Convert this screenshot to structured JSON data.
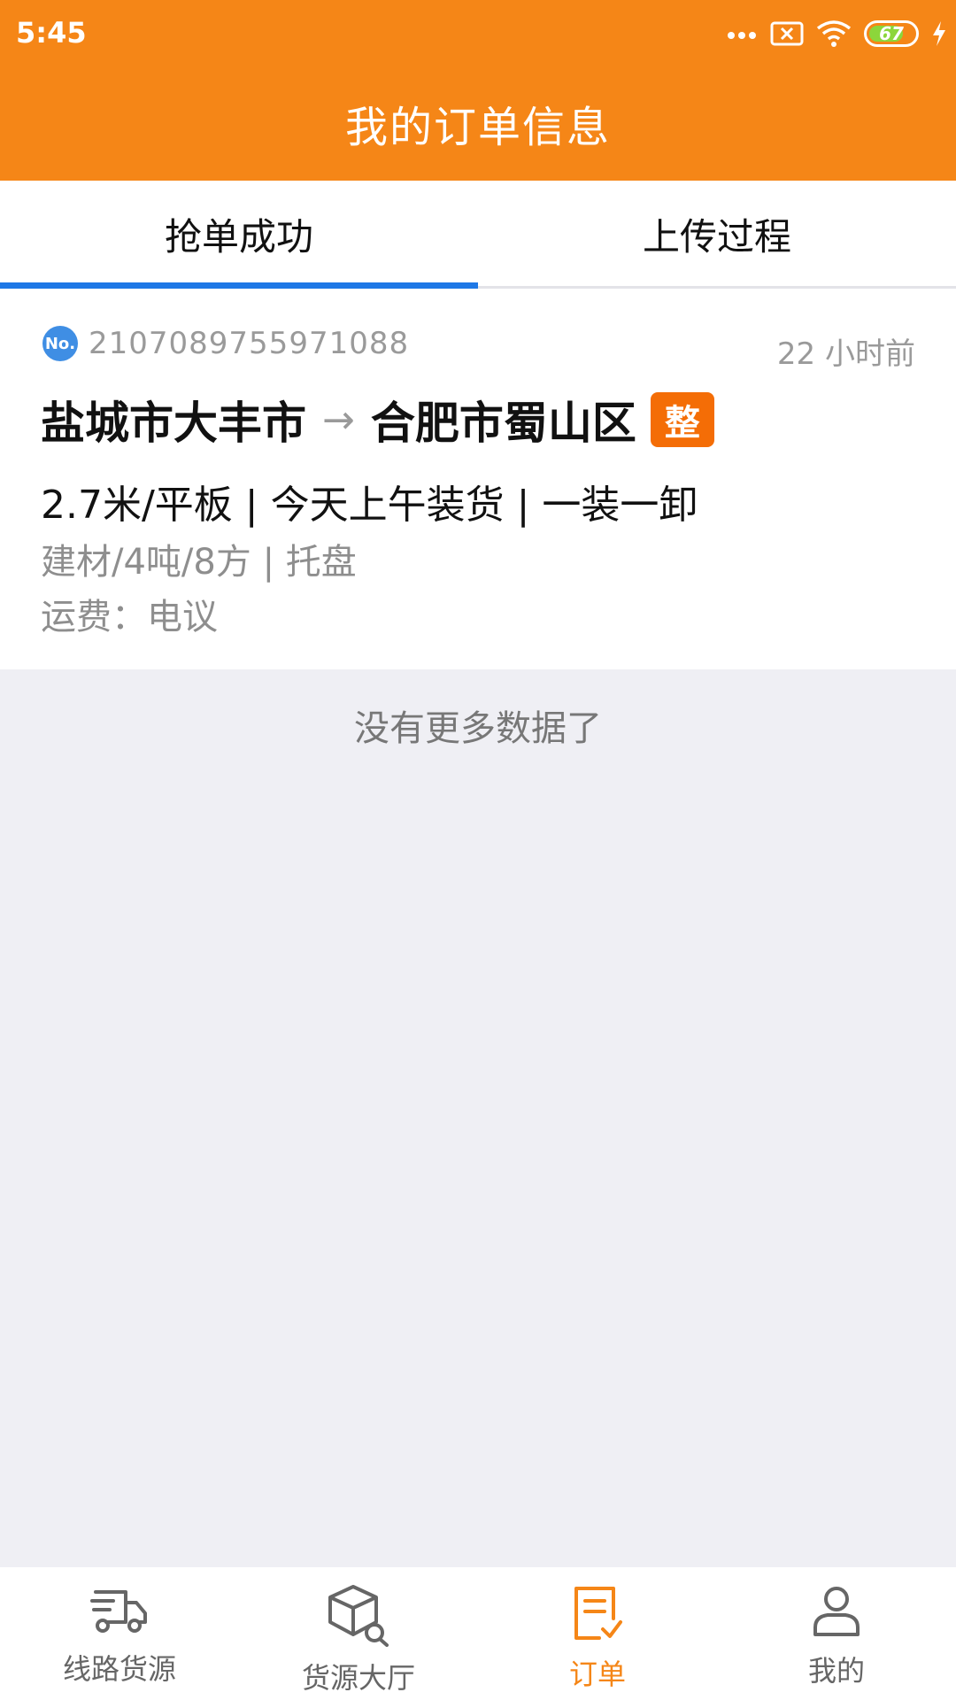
{
  "status_bar": {
    "time": "5:45",
    "battery": "67"
  },
  "header": {
    "title": "我的订单信息"
  },
  "tabs": [
    {
      "label": "抢单成功",
      "active": true
    },
    {
      "label": "上传过程",
      "active": false
    }
  ],
  "order": {
    "badge": "No.",
    "number": "2107089755971088",
    "time_ago": "22 小时前",
    "from": "盐城市大丰市",
    "arrow": "→",
    "to": "合肥市蜀山区",
    "tag": "整",
    "line1": "2.7米/平板 | 今天上午装货 | 一装一卸",
    "line2": "建材/4吨/8方 | 托盘",
    "line3": "运费：电议"
  },
  "list_end": "没有更多数据了",
  "bottom_nav": [
    {
      "label": "线路货源",
      "icon": "truck-icon",
      "active": false
    },
    {
      "label": "货源大厅",
      "icon": "box-search-icon",
      "active": false
    },
    {
      "label": "订单",
      "icon": "order-icon",
      "active": true
    },
    {
      "label": "我的",
      "icon": "user-icon",
      "active": false
    }
  ],
  "colors": {
    "header_bg": "#f58617",
    "tab_indicator": "#1e78e6",
    "tag_bg": "#f46d06",
    "page_bg": "#efeff4",
    "active_nav": "#f58617"
  }
}
